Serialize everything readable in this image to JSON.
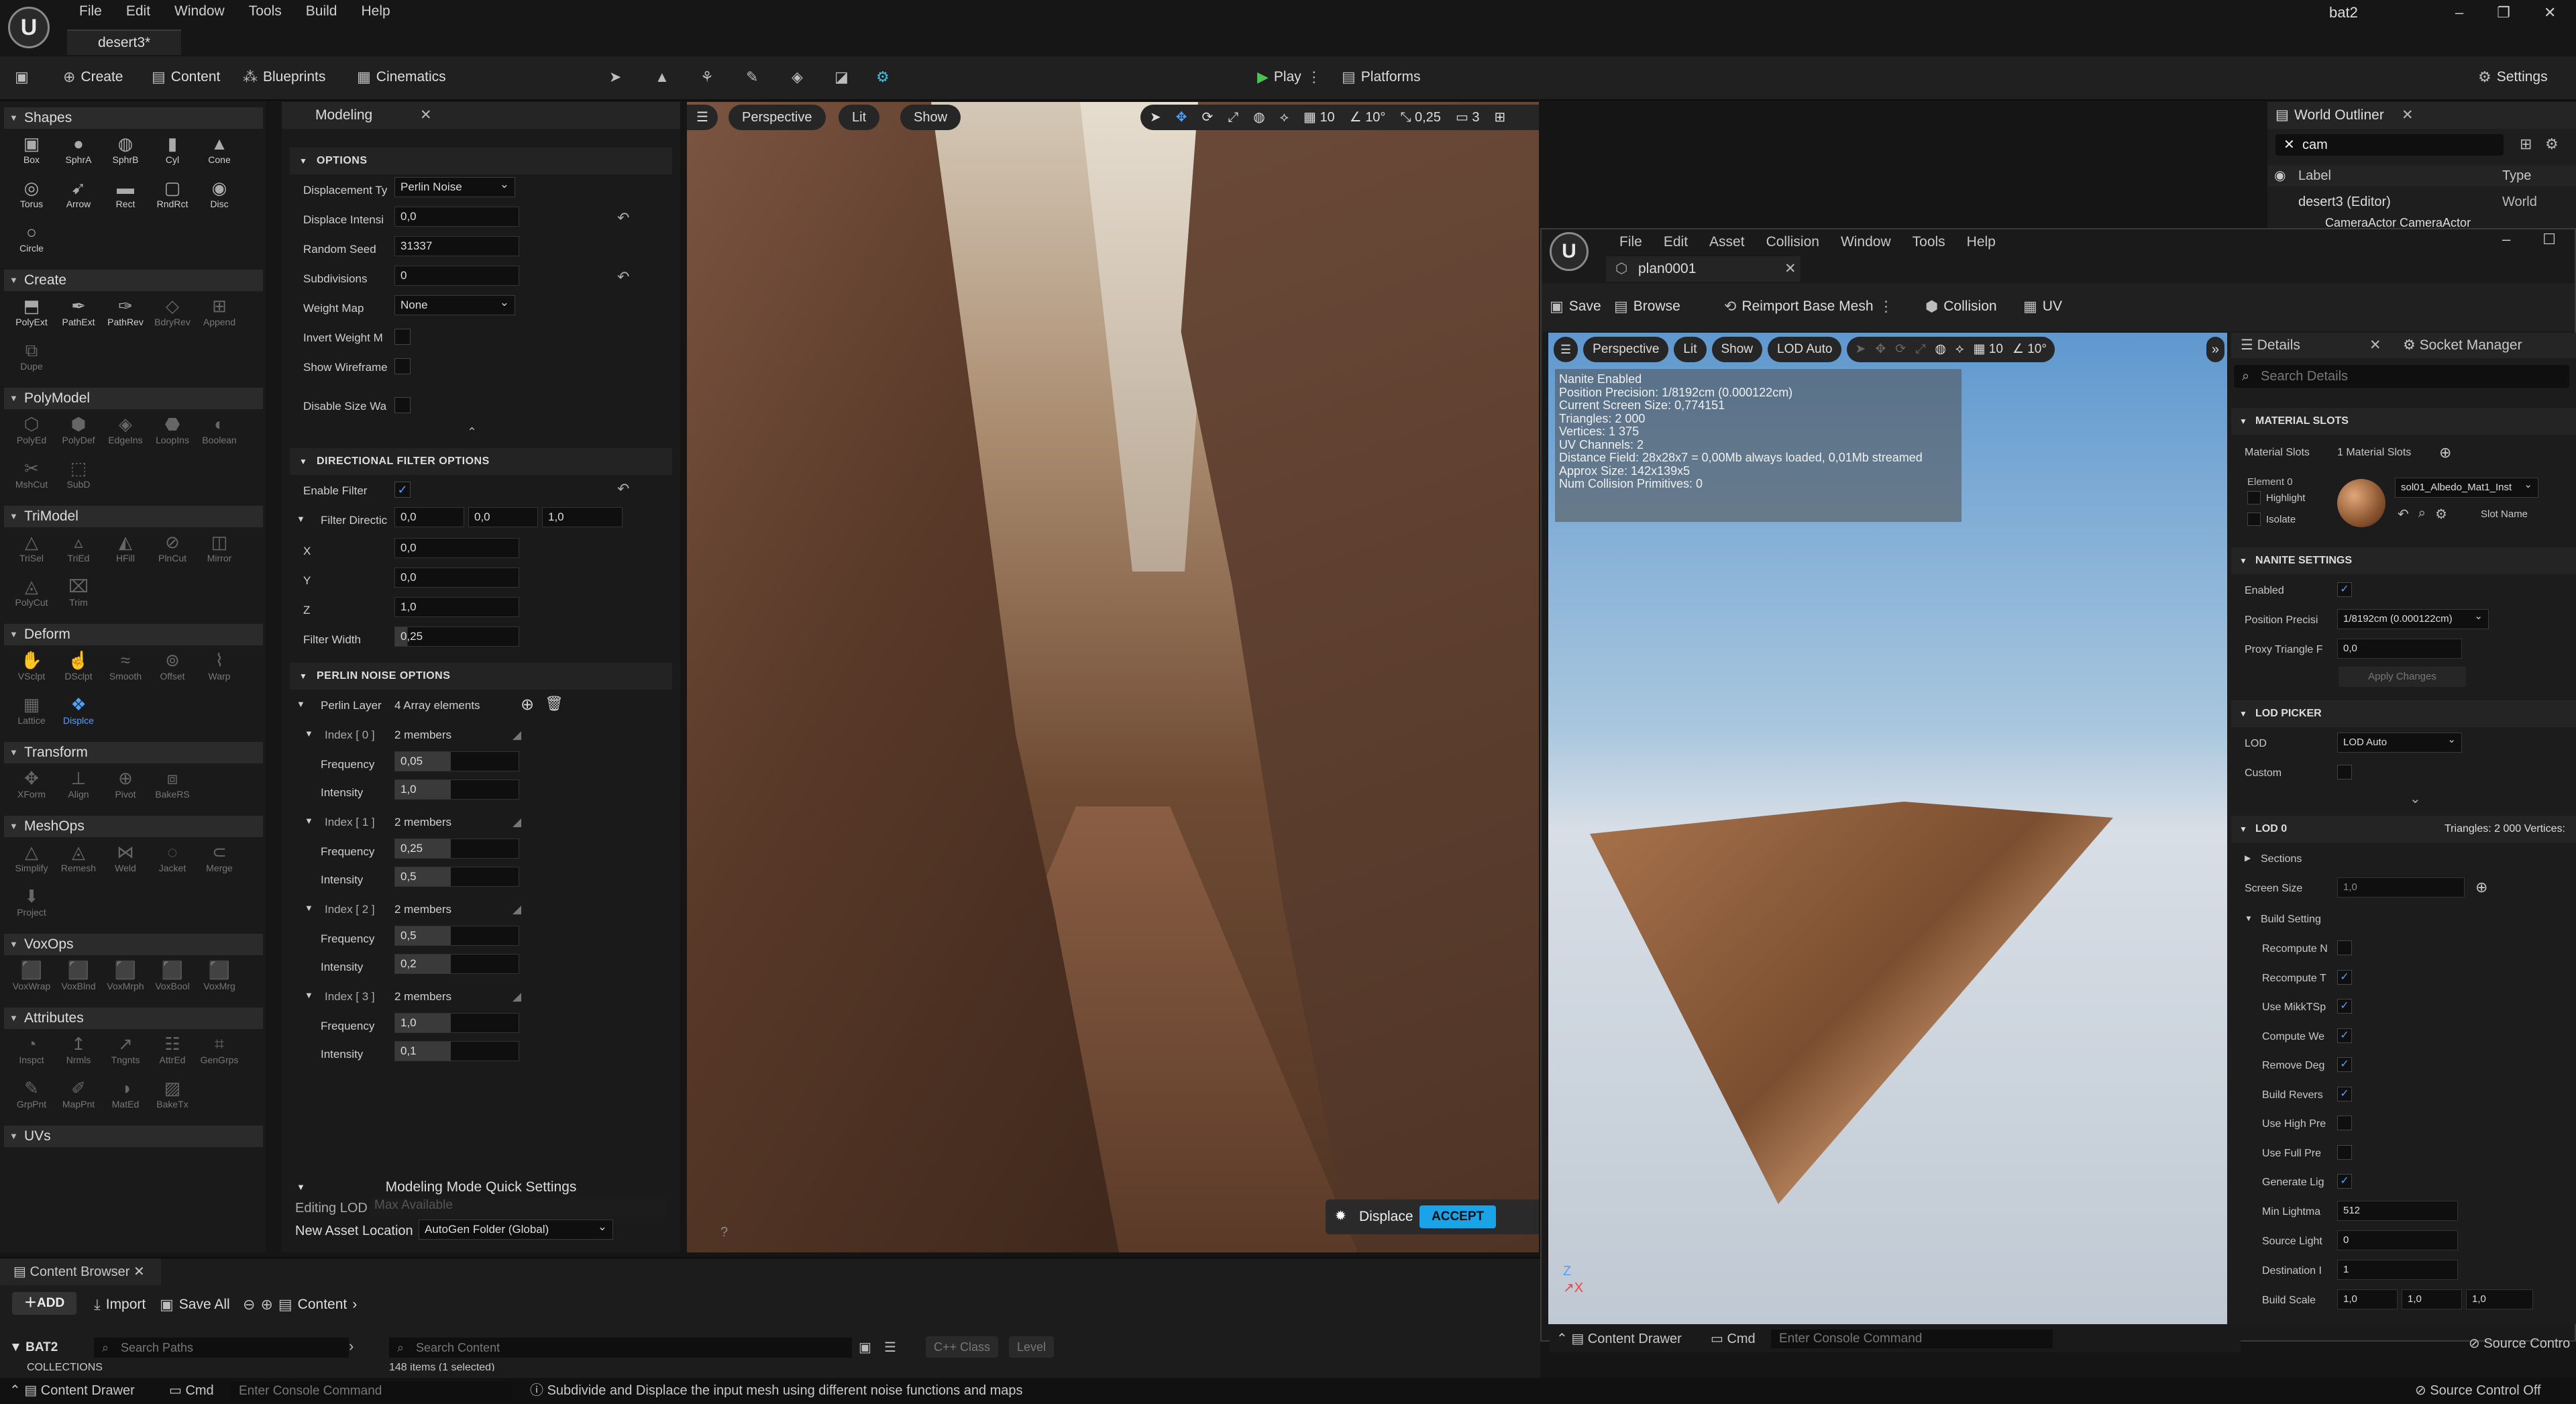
{
  "app": {
    "menu": [
      "File",
      "Edit",
      "Window",
      "Tools",
      "Build",
      "Help"
    ],
    "tab": "desert3*",
    "user": "bat2"
  },
  "toolbar": {
    "create": "Create",
    "content": "Content",
    "blueprints": "Blueprints",
    "cinematics": "Cinematics",
    "play": "Play",
    "platforms": "Platforms",
    "settings": "Settings"
  },
  "left": {
    "sections": [
      {
        "name": "Shapes",
        "tools": [
          "Box",
          "SphrA",
          "SphrB",
          "Cyl",
          "Cone",
          "Torus",
          "Arrow",
          "Rect",
          "RndRct",
          "Disc",
          "Circle"
        ]
      },
      {
        "name": "Create",
        "tools": [
          "PolyExt",
          "PathExt",
          "PathRev",
          "BdryRev",
          "Append",
          "Dupe"
        ]
      },
      {
        "name": "PolyModel",
        "tools": [
          "PolyEd",
          "PolyDef",
          "EdgeIns",
          "LoopIns",
          "Boolean",
          "MshCut",
          "SubD"
        ]
      },
      {
        "name": "TriModel",
        "tools": [
          "TriSel",
          "TriEd",
          "HFill",
          "PlnCut",
          "Mirror",
          "PolyCut",
          "Trim"
        ]
      },
      {
        "name": "Deform",
        "tools": [
          "VSclpt",
          "DSclpt",
          "Smooth",
          "Offset",
          "Warp",
          "Lattice",
          "Displce"
        ]
      },
      {
        "name": "Transform",
        "tools": [
          "XForm",
          "Align",
          "Pivot",
          "BakeRS"
        ]
      },
      {
        "name": "MeshOps",
        "tools": [
          "Simplify",
          "Remesh",
          "Weld",
          "Jacket",
          "Merge",
          "Project"
        ]
      },
      {
        "name": "VoxOps",
        "tools": [
          "VoxWrap",
          "VoxBlnd",
          "VoxMrph",
          "VoxBool",
          "VoxMrg"
        ]
      },
      {
        "name": "Attributes",
        "tools": [
          "Inspct",
          "Nrmls",
          "Tngnts",
          "AttrEd",
          "GenGrps",
          "GrpPnt",
          "MapPnt",
          "MatEd",
          "BakeTx"
        ]
      },
      {
        "name": "UVs",
        "tools": []
      }
    ]
  },
  "modeling": {
    "tab": "Modeling",
    "options_header": "OPTIONS",
    "displacement_type_label": "Displacement Ty",
    "displacement_type": "Perlin Noise",
    "displace_intensity_label": "Displace Intensi",
    "displace_intensity": "0,0",
    "random_seed_label": "Random Seed",
    "random_seed": "31337",
    "subdivisions_label": "Subdivisions",
    "subdivisions": "0",
    "weight_map_label": "Weight Map",
    "weight_map": "None",
    "invert_weight_label": "Invert Weight M",
    "show_wireframe_label": "Show Wireframe",
    "disable_size_label": "Disable Size Wa",
    "directional_header": "DIRECTIONAL FILTER OPTIONS",
    "enable_filter_label": "Enable Filter",
    "filter_direction_label": "Filter Directic",
    "filter_direction": [
      "0,0",
      "0,0",
      "1,0"
    ],
    "x_label": "X",
    "x": "0,0",
    "y_label": "Y",
    "y": "0,0",
    "z_label": "Z",
    "z": "1,0",
    "filter_width_label": "Filter Width",
    "filter_width": "0,25",
    "perlin_header": "PERLIN NOISE OPTIONS",
    "perlin_layers_label": "Perlin Layer",
    "perlin_layers": "4 Array elements",
    "layers": [
      {
        "index": "Index [ 0 ]",
        "members": "2 members",
        "frequency": "0,05",
        "intensity": "1,0"
      },
      {
        "index": "Index [ 1 ]",
        "members": "2 members",
        "frequency": "0,25",
        "intensity": "0,5"
      },
      {
        "index": "Index [ 2 ]",
        "members": "2 members",
        "frequency": "0,5",
        "intensity": "0,2"
      },
      {
        "index": "Index [ 3 ]",
        "members": "2 members",
        "frequency": "1,0",
        "intensity": "0,1"
      }
    ],
    "frequency_label": "Frequency",
    "intensity_label": "Intensity",
    "quick_settings": "Modeling Mode Quick Settings",
    "editing_lod_label": "Editing LOD",
    "editing_lod": "Max Available",
    "new_asset_label": "New Asset Location",
    "new_asset": "AutoGen Folder (Global)"
  },
  "viewport": {
    "perspective": "Perspective",
    "lit": "Lit",
    "show": "Show",
    "grid": "10",
    "angle": "10°",
    "scale": "0,25",
    "cam": "3",
    "displace": "Displace",
    "accept": "ACCEPT"
  },
  "outliner": {
    "title": "World Outliner",
    "search": "cam",
    "label_col": "Label",
    "type_col": "Type",
    "row1": "desert3 (Editor)",
    "row1_type": "World",
    "row2": "CameraActor CameraActor"
  },
  "mesh_editor": {
    "menu": [
      "File",
      "Edit",
      "Asset",
      "Collision",
      "Window",
      "Tools",
      "Help"
    ],
    "tab": "plan0001",
    "save": "Save",
    "browse": "Browse",
    "reimport": "Reimport Base Mesh",
    "collision": "Collision",
    "uv": "UV",
    "vp": {
      "perspective": "Perspective",
      "lit": "Lit",
      "show": "Show",
      "lod": "LOD Auto",
      "grid": "10",
      "angle": "10°"
    },
    "stats": [
      "Nanite Enabled",
      "Position Precision: 1/8192cm (0.000122cm)",
      "Current Screen Size: 0,774151",
      "Triangles: 2 000",
      "Vertices: 1 375",
      "UV Channels: 2",
      "Distance Field: 28x28x7 = 0,00Mb always loaded, 0,01Mb streamed",
      "Approx Size: 142x139x5",
      "Num Collision Primitives: 0"
    ],
    "content_drawer": "Content Drawer",
    "cmd": "Cmd",
    "console_placeholder": "Enter Console Command"
  },
  "details": {
    "title": "Details",
    "socket": "Socket Manager",
    "search_placeholder": "Search Details",
    "material_slots_header": "MATERIAL SLOTS",
    "material_slots_label": "Material Slots",
    "material_slots": "1 Material Slots",
    "element": "Element 0",
    "highlight": "Highlight",
    "isolate": "Isolate",
    "material": "sol01_Albedo_Mat1_Inst",
    "slot_name": "Slot Name",
    "nanite_header": "NANITE SETTINGS",
    "enabled_label": "Enabled",
    "position_label": "Position Precisi",
    "position": "1/8192cm (0.000122cm)",
    "proxy_label": "Proxy Triangle F",
    "proxy": "0,0",
    "apply": "Apply Changes",
    "lod_picker_header": "LOD PICKER",
    "lod_label": "LOD",
    "lod": "LOD Auto",
    "custom_label": "Custom",
    "lod0_header": "LOD 0",
    "lod0_info": "Triangles: 2 000  Vertices:",
    "sections": "Sections",
    "screen_size_label": "Screen Size",
    "screen_size": "1,0",
    "build_setting": "Build Setting",
    "build_rows": [
      {
        "label": "Recompute N",
        "checked": false
      },
      {
        "label": "Recompute T",
        "checked": true
      },
      {
        "label": "Use MikkTSp",
        "checked": true
      },
      {
        "label": "Compute We",
        "checked": true
      },
      {
        "label": "Remove Deg",
        "checked": true
      },
      {
        "label": "Build Revers",
        "checked": true
      },
      {
        "label": "Use High Pre",
        "checked": false
      },
      {
        "label": "Use Full Pre",
        "checked": false
      },
      {
        "label": "Generate Lig",
        "checked": true
      }
    ],
    "min_lightmap_label": "Min Lightma",
    "min_lightmap": "512",
    "source_light_label": "Source Light",
    "source_light": "0",
    "dest_label": "Destination I",
    "dest": "1",
    "build_scale_label": "Build Scale",
    "build_scale": [
      "1,0",
      "1,0",
      "1,0"
    ],
    "source_control": "Source Contro"
  },
  "content_browser": {
    "title": "Content Browser",
    "add": "ADD",
    "import": "Import",
    "save_all": "Save All",
    "content": "Content",
    "root": "BAT2",
    "search_paths": "Search Paths",
    "search_content": "Search Content",
    "cpp_class": "C++ Class",
    "level": "Level",
    "collections": "COLLECTIONS",
    "items": "148 items (1 selected)"
  },
  "status": {
    "content_drawer": "Content Drawer",
    "cmd": "Cmd",
    "console": "Enter Console Command",
    "hint": "Subdivide and Displace the input mesh using different noise functions and maps",
    "source_control": "Source Control Off"
  }
}
